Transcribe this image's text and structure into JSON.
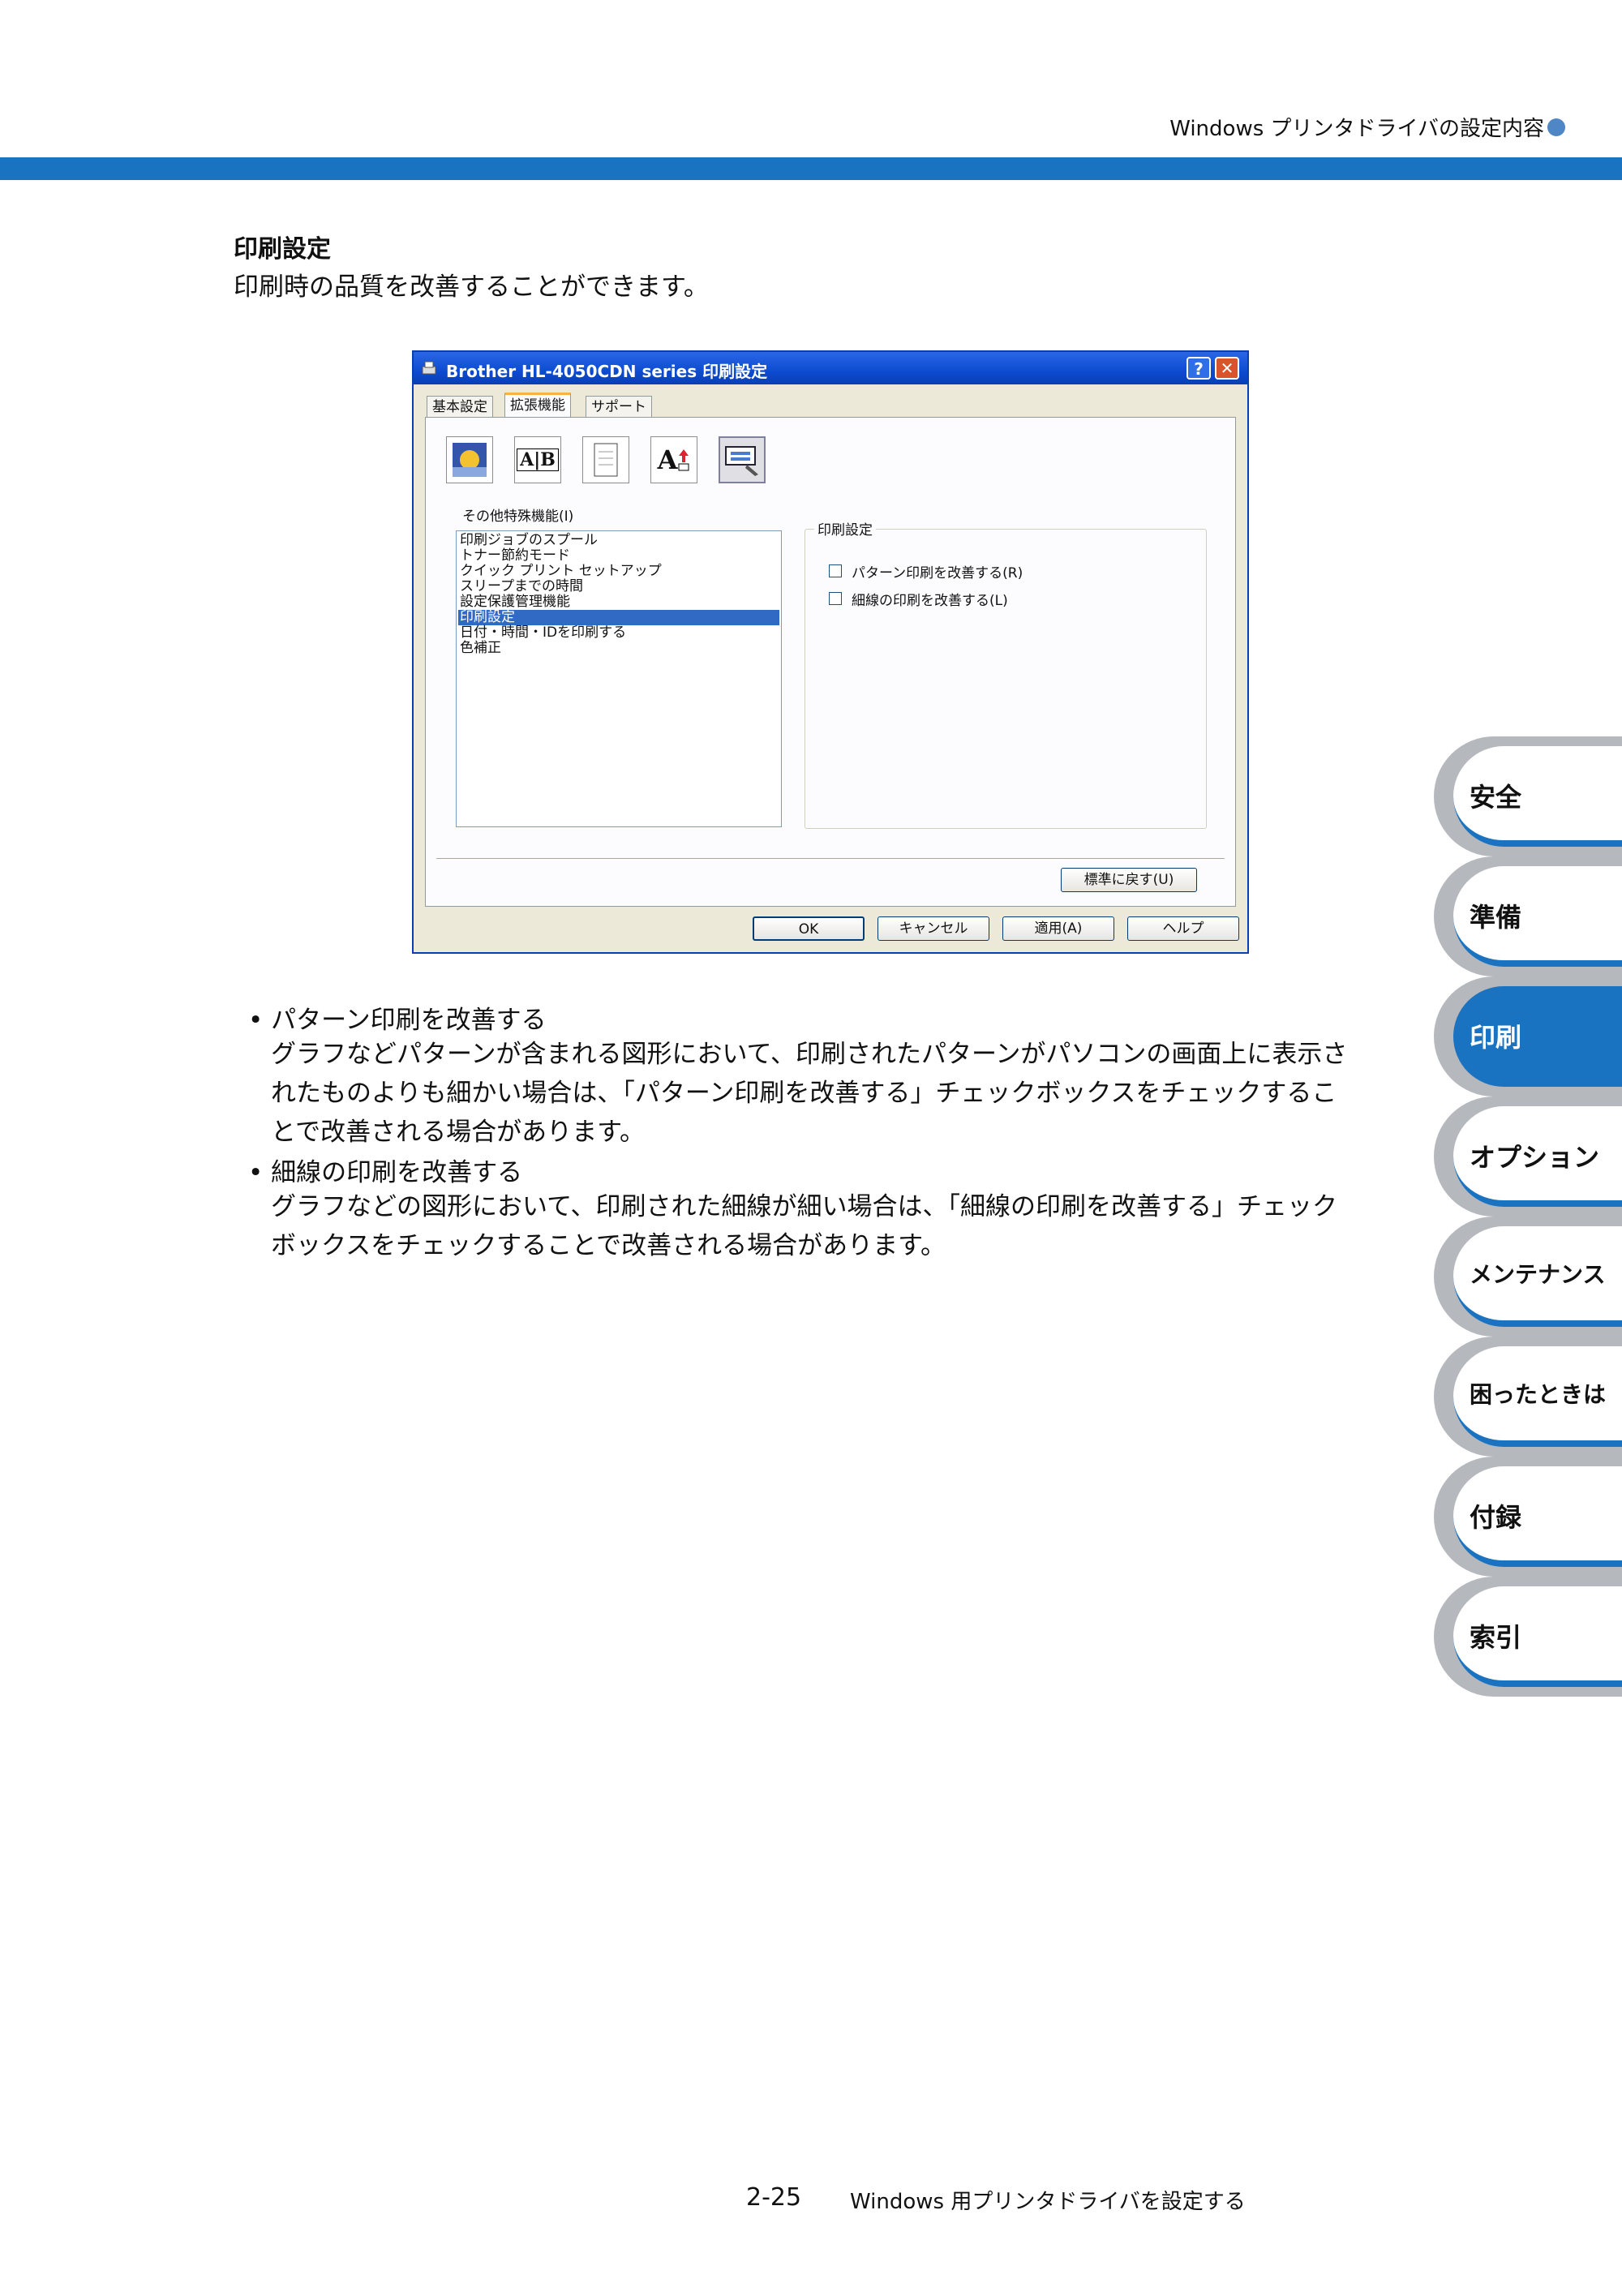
{
  "header": {
    "title": "Windows プリンタドライバの設定内容"
  },
  "section": {
    "title": "印刷設定",
    "description": "印刷時の品質を改善することができます。"
  },
  "dialog": {
    "title": "Brother HL-4050CDN series 印刷設定",
    "help_icon": "?",
    "close_icon": "✕",
    "tabs": [
      "基本設定",
      "拡張機能",
      "サポート"
    ],
    "active_tab": "拡張機能",
    "toolbar_icons": [
      "watermark-icon",
      "ab-icon",
      "copy-icon",
      "font-icon",
      "settings-icon"
    ],
    "toolbar_ab_text": "A|B",
    "toolbar_font_text": "A",
    "list_label": "その他特殊機能(I)",
    "list_items": [
      "印刷ジョブのスプール",
      "トナー節約モード",
      "クイック プリント セットアップ",
      "スリープまでの時間",
      "設定保護管理機能",
      "印刷設定",
      "日付・時間・IDを印刷する",
      "色補正"
    ],
    "selected_index": 5,
    "group_label": "印刷設定",
    "checkboxes": [
      {
        "label": "パターン印刷を改善する(R)",
        "checked": false
      },
      {
        "label": "細線の印刷を改善する(L)",
        "checked": false
      }
    ],
    "default_button": "標準に戻す(U)",
    "buttons": {
      "ok": "OK",
      "cancel": "キャンセル",
      "apply": "適用(A)",
      "help": "ヘルプ"
    }
  },
  "body": {
    "items": [
      {
        "bullet": "• パターン印刷を改善する",
        "lines": [
          "グラフなどパターンが含まれる図形において、印刷されたパターンがパソコンの画面上に表示さ",
          "れたものよりも細かい場合は、「パターン印刷を改善する」チェックボックスをチェックするこ",
          "とで改善される場合があります。"
        ]
      },
      {
        "bullet": "• 細線の印刷を改善する",
        "lines": [
          "グラフなどの図形において、印刷された細線が細い場合は、「細線の印刷を改善する」チェック",
          "ボックスをチェックすることで改善される場合があります。"
        ]
      }
    ]
  },
  "side_tabs": [
    "安全",
    "準備",
    "印刷",
    "オプション",
    "メンテナンス",
    "困ったときは",
    "付録",
    "索引"
  ],
  "active_side_tab": "印刷",
  "footer": {
    "page": "2-25",
    "title": "Windows 用プリンタドライバを設定する"
  },
  "colors": {
    "accent": "#1a73c1",
    "side_tab_ring": "#b5b8bc",
    "selection": "#316ac5"
  }
}
